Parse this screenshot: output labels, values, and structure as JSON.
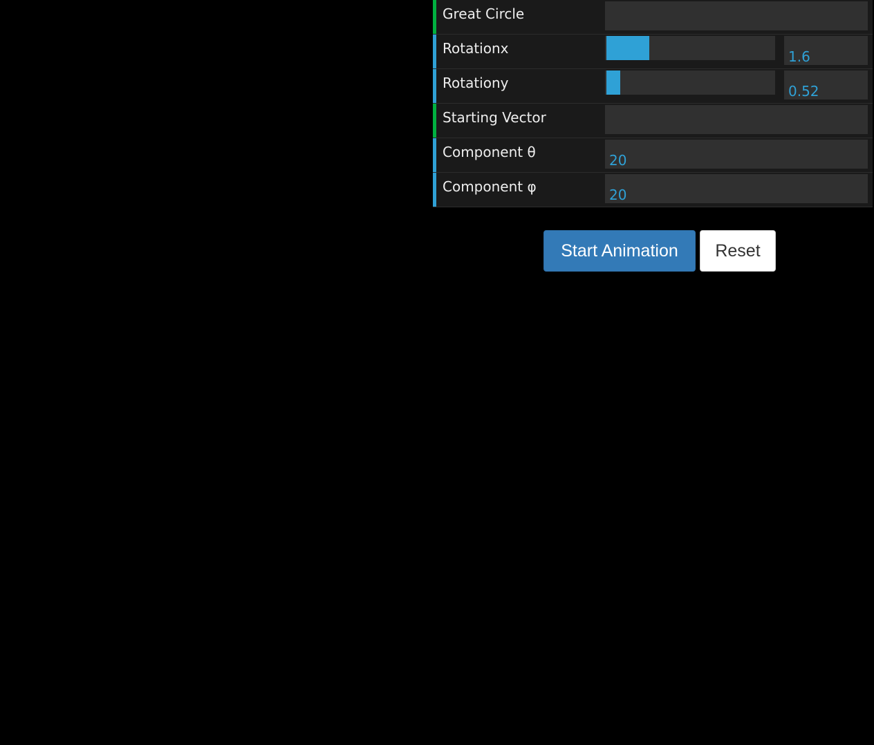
{
  "gui": {
    "rows": [
      {
        "label": "Great Circle",
        "kind": "folder"
      },
      {
        "label": "Rotationx",
        "kind": "slider",
        "value": "1.6",
        "fill_fraction": 0.25
      },
      {
        "label": "Rotationy",
        "kind": "slider",
        "value": "0.52",
        "fill_fraction": 0.08
      },
      {
        "label": "Starting Vector",
        "kind": "folder"
      },
      {
        "label": "Component θ",
        "kind": "number",
        "value": "20"
      },
      {
        "label": "Component φ",
        "kind": "number",
        "value": "20"
      }
    ]
  },
  "buttons": {
    "start_label": "Start Animation",
    "reset_label": "Reset"
  },
  "colors": {
    "folder_accent": "#00b140",
    "number_accent": "#2fa1d6",
    "slider_fill": "#2fa1d6",
    "primary_button": "#337ab7"
  }
}
